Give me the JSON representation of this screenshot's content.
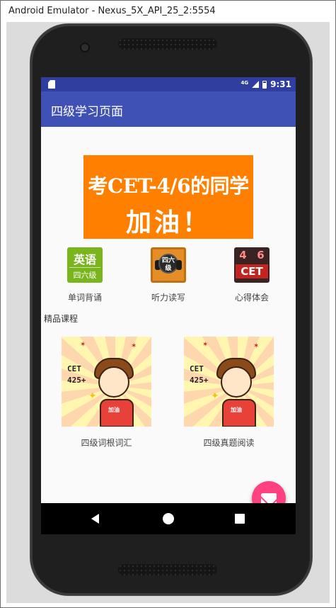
{
  "window": {
    "title": "Android Emulator - Nexus_5X_API_25_2:5554"
  },
  "status_bar": {
    "network": "4G",
    "time": "9:31"
  },
  "app_bar": {
    "title": "四级学习页面"
  },
  "banner": {
    "line1": "考CET-4/6的同学",
    "line2": "加油！"
  },
  "features": [
    {
      "label": "单词背诵",
      "tile_line1": "英语",
      "tile_line2": "四六级"
    },
    {
      "label": "听力读写",
      "tile_text": "四六级"
    },
    {
      "label": "心得体会",
      "tile_num_left": "4",
      "tile_num_right": "6",
      "tile_text": "CET"
    }
  ],
  "section": {
    "title": "精品课程"
  },
  "courses": [
    {
      "label": "四级词根词汇"
    },
    {
      "label": "四级真题阅读"
    }
  ],
  "course_art": {
    "cet_line1": "CET",
    "cet_line2": "425+",
    "shirt": "加油"
  },
  "colors": {
    "status_bar": "#303f9f",
    "app_bar": "#3f51b5",
    "banner": "#ff7f00",
    "fab": "#ff4081"
  },
  "fab": {
    "icon": "mail-icon"
  }
}
